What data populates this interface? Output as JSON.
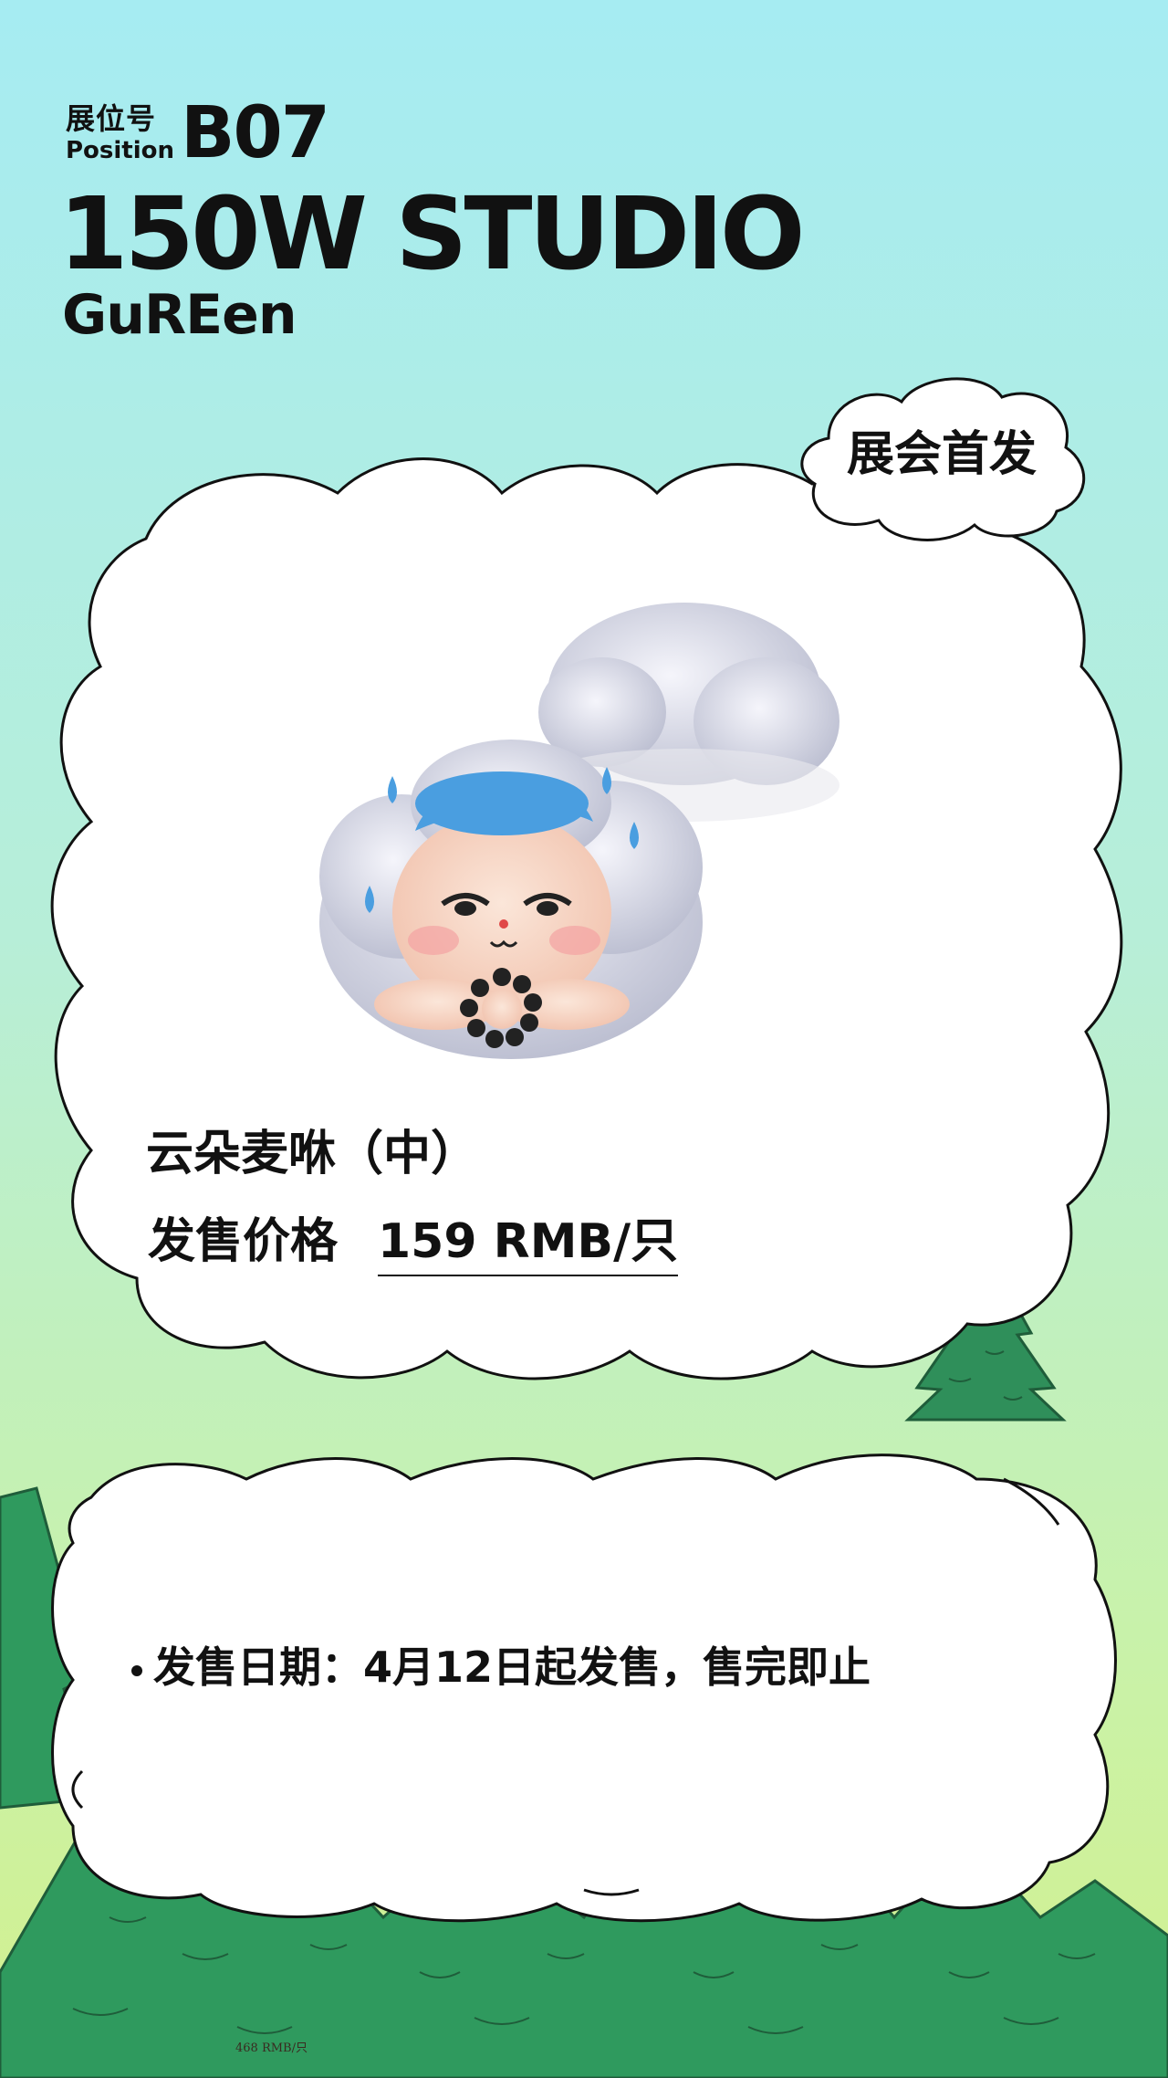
{
  "header": {
    "position_label_zh": "展位号",
    "position_label_en": "Position",
    "position_code": "B07",
    "studio_name": "150W STUDIO",
    "brand": "GuREen"
  },
  "badge": {
    "text": "展会首发"
  },
  "product": {
    "name": "云朵麦咻（中）",
    "price_label": "发售价格",
    "price_value": "159 RMB/只"
  },
  "release": {
    "text": "发售日期：4月12日起发售，售完即止"
  },
  "footnote": {
    "text": "468 RMB/只"
  },
  "colors": {
    "bg_top": "#a6ecf2",
    "bg_bottom": "#d3f08e",
    "tree_green": "#2f8f5a",
    "cloud_white": "#ffffff",
    "text": "#111111"
  }
}
